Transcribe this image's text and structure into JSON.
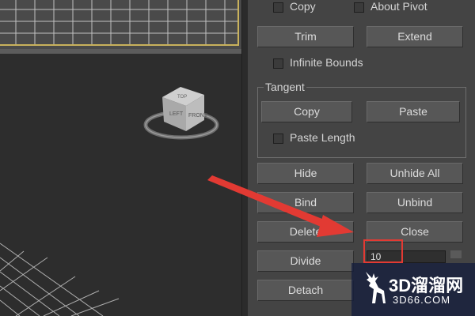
{
  "panel": {
    "copy_check_label": "Copy",
    "about_pivot_label": "About Pivot",
    "trim_label": "Trim",
    "extend_label": "Extend",
    "infinite_bounds_label": "Infinite Bounds",
    "tangent_group_title": "Tangent",
    "tangent_copy_label": "Copy",
    "tangent_paste_label": "Paste",
    "paste_length_label": "Paste Length",
    "hide_label": "Hide",
    "unhide_all_label": "Unhide All",
    "bind_label": "Bind",
    "unbind_label": "Unbind",
    "delete_label": "Delete",
    "close_label": "Close",
    "divide_label": "Divide",
    "divide_value": "10",
    "detach_label": "Detach"
  },
  "viewcube": {
    "face_front": "LEFT",
    "face_right": "FRONT",
    "face_top": "TOP"
  },
  "watermark": {
    "title": "3D溜溜网",
    "subtitle": "3D66.COM"
  },
  "colors": {
    "annotation": "#e23a33",
    "viewport_border": "#c9b25c"
  }
}
